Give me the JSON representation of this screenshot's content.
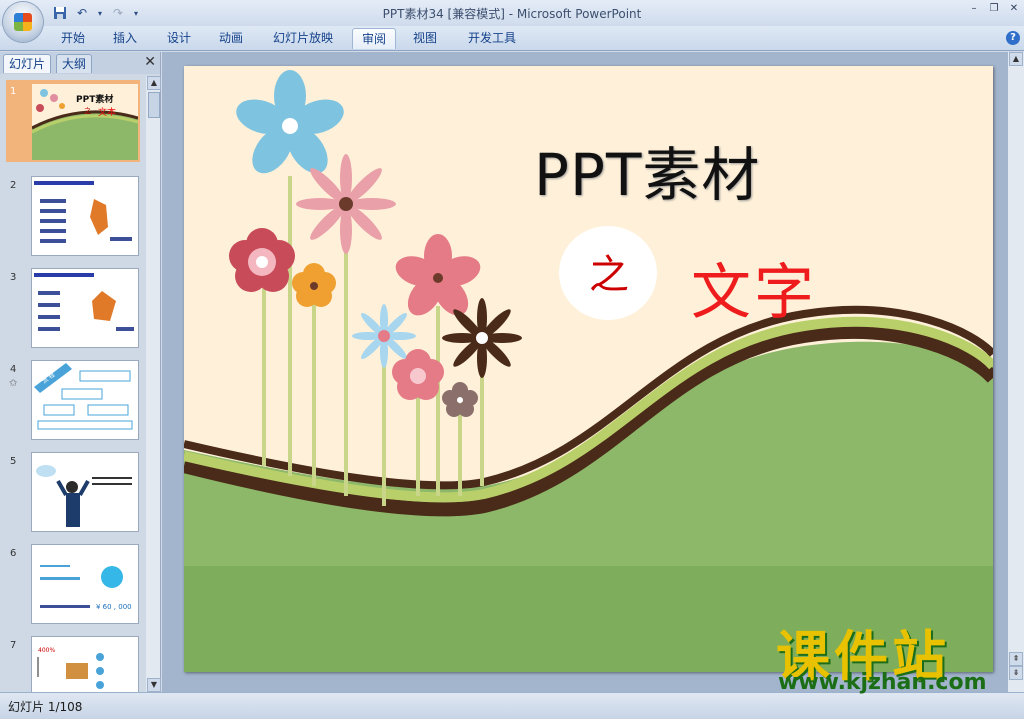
{
  "window": {
    "title": "PPT素材34 [兼容模式] - Microsoft PowerPoint"
  },
  "ribbon": {
    "tabs": [
      "开始",
      "插入",
      "设计",
      "动画",
      "幻灯片放映",
      "审阅",
      "视图",
      "开发工具"
    ],
    "active_tab": "审阅"
  },
  "pane": {
    "tabs": [
      "幻灯片",
      "大纲"
    ],
    "active_tab": "幻灯片"
  },
  "thumbnails": [
    {
      "num": "1",
      "title": "PPT素材",
      "zhi": "之",
      "sub": "文本"
    },
    {
      "num": "2"
    },
    {
      "num": "3"
    },
    {
      "num": "4",
      "caption": "流 程"
    },
    {
      "num": "5"
    },
    {
      "num": "6",
      "price": "¥ 60 , 000"
    },
    {
      "num": "7",
      "pct": "400%"
    }
  ],
  "slide": {
    "title": "PPT素材",
    "zhi": "之",
    "subtitle": "文字"
  },
  "status": {
    "text": "幻灯片 1/108"
  },
  "watermark": {
    "big": "课件站",
    "url": "www.kjzhan.com"
  },
  "colors": {
    "slide_bg": "#fff1d9",
    "title_red": "#ee1c1c",
    "wave_brown": "#4a2a18",
    "wave_green": "#b9d06a",
    "grass": "#8db86a"
  }
}
